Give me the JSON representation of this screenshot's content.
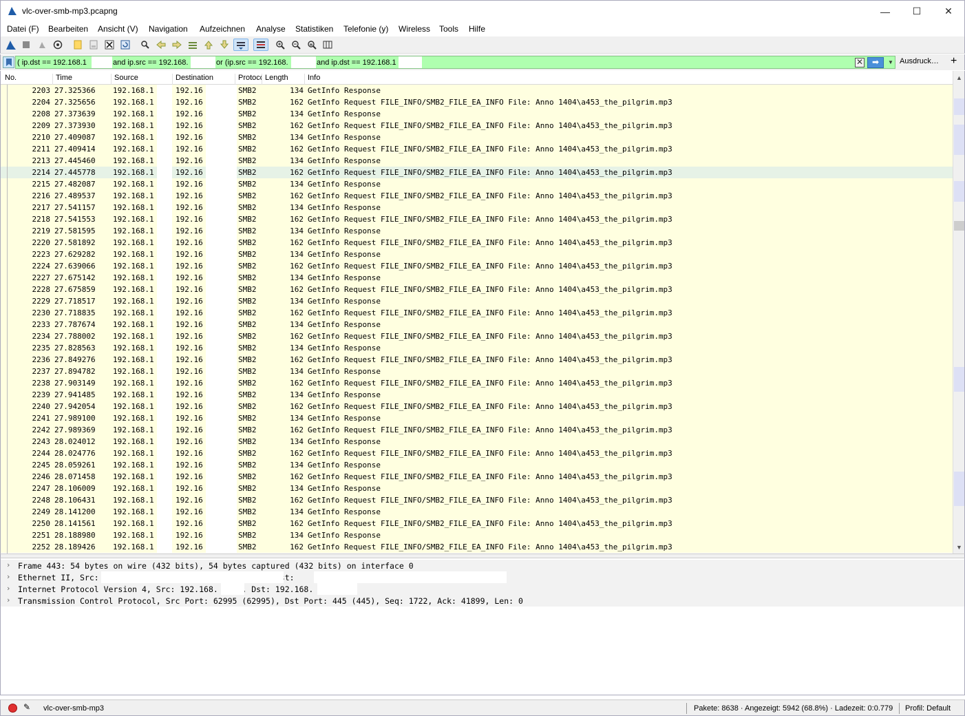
{
  "window": {
    "title": "vlc-over-smb-mp3.pcapng",
    "minimize_glyph": "—",
    "maximize_glyph": "☐",
    "close_glyph": "✕"
  },
  "menu": [
    "Datei (F)",
    "Bearbeiten",
    "Ansicht (V)",
    "Navigation",
    "Aufzeichnen",
    "Analyse",
    "Statistiken",
    "Telefonie (y)",
    "Wireless",
    "Tools",
    "Hilfe"
  ],
  "toolbar": {
    "icons": [
      "shark-fin-start-icon",
      "stop-capture-icon",
      "restart-capture-icon",
      "capture-options-icon",
      "open-file-icon",
      "save-file-icon",
      "close-file-icon",
      "reload-file-icon",
      "find-packet-icon",
      "go-back-icon",
      "go-forward-icon",
      "go-to-packet-icon",
      "go-first-icon",
      "go-last-icon",
      "autoscroll-icon",
      "colorize-icon",
      "zoom-in-icon",
      "zoom-out-icon",
      "zoom-normal-icon",
      "resize-columns-icon"
    ]
  },
  "filter": {
    "segments": [
      "( ip.dst == 192.168.1",
      "and ip.src == 192.168.",
      "or (ip.src == 192.168.",
      "and ip.dst == 192.168.1"
    ],
    "clear_glyph": "✕",
    "apply_glyph": "➡",
    "dropdown_glyph": "▼",
    "expression_label": "Ausdruck…",
    "add_glyph": "+"
  },
  "packet_list": {
    "columns": [
      "No.",
      "Time",
      "Source",
      "Destination",
      "Protocol",
      "Length",
      "Info"
    ],
    "selected_no": "2214",
    "rows": [
      {
        "no": "2203",
        "time": "27.325366",
        "src": "192.168.1",
        "dst": "192.16",
        "proto": "SMB2",
        "len": "134",
        "info": "GetInfo Response"
      },
      {
        "no": "2204",
        "time": "27.325656",
        "src": "192.168.1",
        "dst": "192.16",
        "proto": "SMB2",
        "len": "162",
        "info": "GetInfo Request FILE_INFO/SMB2_FILE_EA_INFO File: Anno 1404\\a453_the_pilgrim.mp3"
      },
      {
        "no": "2208",
        "time": "27.373639",
        "src": "192.168.1",
        "dst": "192.16",
        "proto": "SMB2",
        "len": "134",
        "info": "GetInfo Response"
      },
      {
        "no": "2209",
        "time": "27.373930",
        "src": "192.168.1",
        "dst": "192.16",
        "proto": "SMB2",
        "len": "162",
        "info": "GetInfo Request FILE_INFO/SMB2_FILE_EA_INFO File: Anno 1404\\a453_the_pilgrim.mp3"
      },
      {
        "no": "2210",
        "time": "27.409087",
        "src": "192.168.1",
        "dst": "192.16",
        "proto": "SMB2",
        "len": "134",
        "info": "GetInfo Response"
      },
      {
        "no": "2211",
        "time": "27.409414",
        "src": "192.168.1",
        "dst": "192.16",
        "proto": "SMB2",
        "len": "162",
        "info": "GetInfo Request FILE_INFO/SMB2_FILE_EA_INFO File: Anno 1404\\a453_the_pilgrim.mp3"
      },
      {
        "no": "2213",
        "time": "27.445460",
        "src": "192.168.1",
        "dst": "192.16",
        "proto": "SMB2",
        "len": "134",
        "info": "GetInfo Response"
      },
      {
        "no": "2214",
        "time": "27.445778",
        "src": "192.168.1",
        "dst": "192.16",
        "proto": "SMB2",
        "len": "162",
        "info": "GetInfo Request FILE_INFO/SMB2_FILE_EA_INFO File: Anno 1404\\a453_the_pilgrim.mp3"
      },
      {
        "no": "2215",
        "time": "27.482087",
        "src": "192.168.1",
        "dst": "192.16",
        "proto": "SMB2",
        "len": "134",
        "info": "GetInfo Response"
      },
      {
        "no": "2216",
        "time": "27.489537",
        "src": "192.168.1",
        "dst": "192.16",
        "proto": "SMB2",
        "len": "162",
        "info": "GetInfo Request FILE_INFO/SMB2_FILE_EA_INFO File: Anno 1404\\a453_the_pilgrim.mp3"
      },
      {
        "no": "2217",
        "time": "27.541157",
        "src": "192.168.1",
        "dst": "192.16",
        "proto": "SMB2",
        "len": "134",
        "info": "GetInfo Response"
      },
      {
        "no": "2218",
        "time": "27.541553",
        "src": "192.168.1",
        "dst": "192.16",
        "proto": "SMB2",
        "len": "162",
        "info": "GetInfo Request FILE_INFO/SMB2_FILE_EA_INFO File: Anno 1404\\a453_the_pilgrim.mp3"
      },
      {
        "no": "2219",
        "time": "27.581595",
        "src": "192.168.1",
        "dst": "192.16",
        "proto": "SMB2",
        "len": "134",
        "info": "GetInfo Response"
      },
      {
        "no": "2220",
        "time": "27.581892",
        "src": "192.168.1",
        "dst": "192.16",
        "proto": "SMB2",
        "len": "162",
        "info": "GetInfo Request FILE_INFO/SMB2_FILE_EA_INFO File: Anno 1404\\a453_the_pilgrim.mp3"
      },
      {
        "no": "2223",
        "time": "27.629282",
        "src": "192.168.1",
        "dst": "192.16",
        "proto": "SMB2",
        "len": "134",
        "info": "GetInfo Response"
      },
      {
        "no": "2224",
        "time": "27.639066",
        "src": "192.168.1",
        "dst": "192.16",
        "proto": "SMB2",
        "len": "162",
        "info": "GetInfo Request FILE_INFO/SMB2_FILE_EA_INFO File: Anno 1404\\a453_the_pilgrim.mp3"
      },
      {
        "no": "2227",
        "time": "27.675142",
        "src": "192.168.1",
        "dst": "192.16",
        "proto": "SMB2",
        "len": "134",
        "info": "GetInfo Response"
      },
      {
        "no": "2228",
        "time": "27.675859",
        "src": "192.168.1",
        "dst": "192.16",
        "proto": "SMB2",
        "len": "162",
        "info": "GetInfo Request FILE_INFO/SMB2_FILE_EA_INFO File: Anno 1404\\a453_the_pilgrim.mp3"
      },
      {
        "no": "2229",
        "time": "27.718517",
        "src": "192.168.1",
        "dst": "192.16",
        "proto": "SMB2",
        "len": "134",
        "info": "GetInfo Response"
      },
      {
        "no": "2230",
        "time": "27.718835",
        "src": "192.168.1",
        "dst": "192.16",
        "proto": "SMB2",
        "len": "162",
        "info": "GetInfo Request FILE_INFO/SMB2_FILE_EA_INFO File: Anno 1404\\a453_the_pilgrim.mp3"
      },
      {
        "no": "2233",
        "time": "27.787674",
        "src": "192.168.1",
        "dst": "192.16",
        "proto": "SMB2",
        "len": "134",
        "info": "GetInfo Response"
      },
      {
        "no": "2234",
        "time": "27.788002",
        "src": "192.168.1",
        "dst": "192.16",
        "proto": "SMB2",
        "len": "162",
        "info": "GetInfo Request FILE_INFO/SMB2_FILE_EA_INFO File: Anno 1404\\a453_the_pilgrim.mp3"
      },
      {
        "no": "2235",
        "time": "27.828563",
        "src": "192.168.1",
        "dst": "192.16",
        "proto": "SMB2",
        "len": "134",
        "info": "GetInfo Response"
      },
      {
        "no": "2236",
        "time": "27.849276",
        "src": "192.168.1",
        "dst": "192.16",
        "proto": "SMB2",
        "len": "162",
        "info": "GetInfo Request FILE_INFO/SMB2_FILE_EA_INFO File: Anno 1404\\a453_the_pilgrim.mp3"
      },
      {
        "no": "2237",
        "time": "27.894782",
        "src": "192.168.1",
        "dst": "192.16",
        "proto": "SMB2",
        "len": "134",
        "info": "GetInfo Response"
      },
      {
        "no": "2238",
        "time": "27.903149",
        "src": "192.168.1",
        "dst": "192.16",
        "proto": "SMB2",
        "len": "162",
        "info": "GetInfo Request FILE_INFO/SMB2_FILE_EA_INFO File: Anno 1404\\a453_the_pilgrim.mp3"
      },
      {
        "no": "2239",
        "time": "27.941485",
        "src": "192.168.1",
        "dst": "192.16",
        "proto": "SMB2",
        "len": "134",
        "info": "GetInfo Response"
      },
      {
        "no": "2240",
        "time": "27.942054",
        "src": "192.168.1",
        "dst": "192.16",
        "proto": "SMB2",
        "len": "162",
        "info": "GetInfo Request FILE_INFO/SMB2_FILE_EA_INFO File: Anno 1404\\a453_the_pilgrim.mp3"
      },
      {
        "no": "2241",
        "time": "27.989100",
        "src": "192.168.1",
        "dst": "192.16",
        "proto": "SMB2",
        "len": "134",
        "info": "GetInfo Response"
      },
      {
        "no": "2242",
        "time": "27.989369",
        "src": "192.168.1",
        "dst": "192.16",
        "proto": "SMB2",
        "len": "162",
        "info": "GetInfo Request FILE_INFO/SMB2_FILE_EA_INFO File: Anno 1404\\a453_the_pilgrim.mp3"
      },
      {
        "no": "2243",
        "time": "28.024012",
        "src": "192.168.1",
        "dst": "192.16",
        "proto": "SMB2",
        "len": "134",
        "info": "GetInfo Response"
      },
      {
        "no": "2244",
        "time": "28.024776",
        "src": "192.168.1",
        "dst": "192.16",
        "proto": "SMB2",
        "len": "162",
        "info": "GetInfo Request FILE_INFO/SMB2_FILE_EA_INFO File: Anno 1404\\a453_the_pilgrim.mp3"
      },
      {
        "no": "2245",
        "time": "28.059261",
        "src": "192.168.1",
        "dst": "192.16",
        "proto": "SMB2",
        "len": "134",
        "info": "GetInfo Response"
      },
      {
        "no": "2246",
        "time": "28.071458",
        "src": "192.168.1",
        "dst": "192.16",
        "proto": "SMB2",
        "len": "162",
        "info": "GetInfo Request FILE_INFO/SMB2_FILE_EA_INFO File: Anno 1404\\a453_the_pilgrim.mp3"
      },
      {
        "no": "2247",
        "time": "28.106009",
        "src": "192.168.1",
        "dst": "192.16",
        "proto": "SMB2",
        "len": "134",
        "info": "GetInfo Response"
      },
      {
        "no": "2248",
        "time": "28.106431",
        "src": "192.168.1",
        "dst": "192.16",
        "proto": "SMB2",
        "len": "162",
        "info": "GetInfo Request FILE_INFO/SMB2_FILE_EA_INFO File: Anno 1404\\a453_the_pilgrim.mp3"
      },
      {
        "no": "2249",
        "time": "28.141200",
        "src": "192.168.1",
        "dst": "192.16",
        "proto": "SMB2",
        "len": "134",
        "info": "GetInfo Response"
      },
      {
        "no": "2250",
        "time": "28.141561",
        "src": "192.168.1",
        "dst": "192.16",
        "proto": "SMB2",
        "len": "162",
        "info": "GetInfo Request FILE_INFO/SMB2_FILE_EA_INFO File: Anno 1404\\a453_the_pilgrim.mp3"
      },
      {
        "no": "2251",
        "time": "28.188980",
        "src": "192.168.1",
        "dst": "192.16",
        "proto": "SMB2",
        "len": "134",
        "info": "GetInfo Response"
      },
      {
        "no": "2252",
        "time": "28.189426",
        "src": "192.168.1",
        "dst": "192.16",
        "proto": "SMB2",
        "len": "162",
        "info": "GetInfo Request FILE_INFO/SMB2_FILE_EA_INFO File: Anno 1404\\a453_the_pilgrim.mp3"
      }
    ],
    "scroll_up_glyph": "▲",
    "scroll_down_glyph": "▼"
  },
  "details": {
    "chevron_glyph": "›",
    "lines": [
      "Frame 443: 54 bytes on wire (432 bits), 54 bytes captured (432 bits) on interface 0",
      "Ethernet II, Src:                                   , Dst:",
      "Internet Protocol Version 4, Src: 192.168.     , Dst: 192.168.",
      "Transmission Control Protocol, Src Port: 62995 (62995), Dst Port: 445 (445), Seq: 1722, Ack: 41899, Len: 0"
    ]
  },
  "status": {
    "edit_glyph": "✎",
    "file": "vlc-over-smb-mp3",
    "stats": "Pakete: 8638 · Angezeigt: 5942 (68.8%) · Ladezeit: 0:0.779",
    "profile": "Profil: Default"
  },
  "colors": {
    "row_bg": "#ffffe0",
    "selected_row_bg": "#e6f2e6",
    "filter_valid": "#afffaf",
    "capture_led": "#e03030"
  }
}
